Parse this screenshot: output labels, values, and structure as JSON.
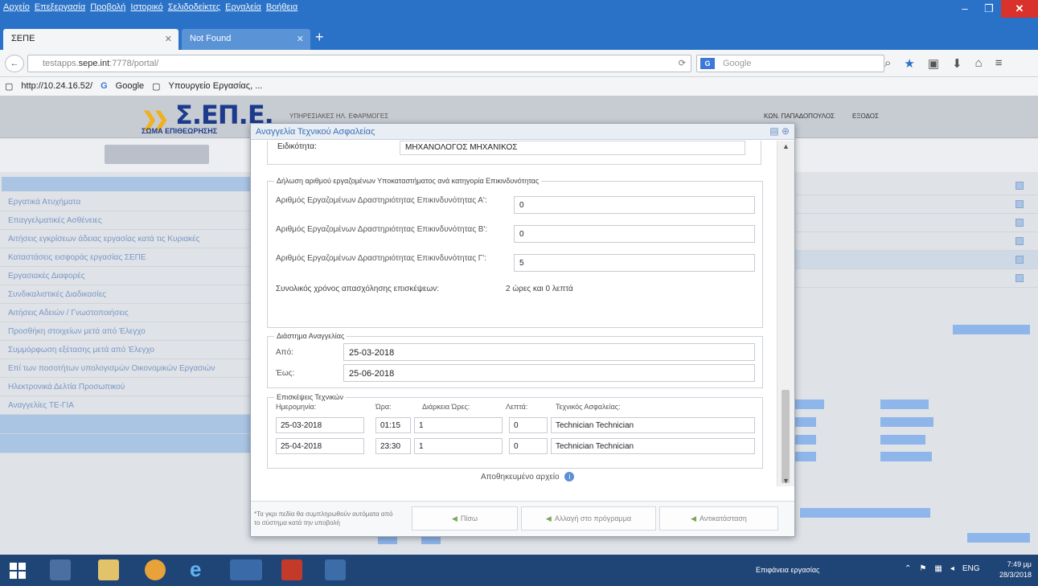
{
  "browser": {
    "menu": [
      "Αρχείο",
      "Επεξεργασία",
      "Προβολή",
      "Ιστορικό",
      "Σελιδοδείκτες",
      "Εργαλεία",
      "Βοήθεια"
    ],
    "tabs": [
      {
        "label": "ΣΕΠΕ"
      },
      {
        "label": "Not Found"
      }
    ],
    "url_prefix": "testapps.",
    "url_host": "sepe.int",
    "url_suffix": ":7778/portal/",
    "search_placeholder": "Google",
    "bookmarks": [
      "http://10.24.16.52/",
      "Google",
      "Υπουργείο Εργασίας, ..."
    ]
  },
  "header": {
    "logo_text": "Σ.ΕΠ.Ε.",
    "logo_subtitle": "ΣΩΜΑ ΕΠΙΘΕΩΡΗΣΗΣ",
    "subtitle": "ΥΠΗΡΕΣΙΑΚΕΣ ΗΛ. ΕΦΑΡΜΟΓΕΣ",
    "user": "ΚΩΝ. ΠΑΠΑΔΟΠΟΥΛΟΣ",
    "logout": "ΕΞΟΔΟΣ"
  },
  "sidebar": {
    "items": [
      "Εργατικά Ατυχήματα",
      "Επαγγελματικές Ασθένειες",
      "Αιτήσεις εγκρίσεων άδειας εργασίας κατά τις Κυριακές",
      "Καταστάσεις εισφοράς εργασίας ΣΕΠΕ",
      "Εργασιακές Διαφορές",
      "Συνδικαλιστικές Διαδικασίες",
      "Αιτήσεις Αδειών / Γνωστοποιήσεις",
      "Προσθήκη στοιχείων μετά από Έλεγχο",
      "Συμμόρφωση εξέτασης μετά από Έλεγχο",
      "Επί των ποσοτήτων υπολογισμών Οικονομικών Εργασιών",
      "Ηλεκτρονικά Δελτία Προσωπικού",
      "Αναγγελίες ΤΕ-ΓΙΑ"
    ]
  },
  "modal": {
    "title": "Αναγγελία Τεχνικού Ασφαλείας",
    "specialty_label": "Ειδικότητα:",
    "specialty_value": "ΜΗΧΑΝΟΛΟΓΟΣ ΜΗΧΑΝΙΚΟΣ",
    "employees_legend": "Δήλωση αριθμού εργαζομένων Υποκαταστήματος ανά κατηγορία Επικινδυνότητας",
    "employees": [
      {
        "label": "Αριθμός Εργαζομένων Δραστηριότητας Επικινδυνότητας Α':",
        "value": "0"
      },
      {
        "label": "Αριθμός Εργαζομένων Δραστηριότητας Επικινδυνότητας Β':",
        "value": "0"
      },
      {
        "label": "Αριθμός Εργαζομένων Δραστηριότητας Επικινδυνότητας Γ':",
        "value": "5"
      }
    ],
    "total_label": "Συνολικός χρόνος απασχόλησης επισκέψεων:",
    "total_value": "2 ώρες και 0 λεπτά",
    "period_legend": "Διάστημα Αναγγελίας",
    "from_label": "Από:",
    "from_value": "25-03-2018",
    "to_label": "Έως:",
    "to_value": "25-06-2018",
    "visits_legend": "Επισκέψεις Τεχνικών",
    "visit_headers": [
      "Ημερομηνία:",
      "Ώρα:",
      "Διάρκεια Ώρες:",
      "Λεπτά:",
      "Τεχνικός Ασφαλείας:"
    ],
    "visits": [
      {
        "date": "25-03-2018",
        "time": "01:15",
        "hours": "1",
        "minutes": "0",
        "tech": "Technician Technician"
      },
      {
        "date": "25-04-2018",
        "time": "23:30",
        "hours": "1",
        "minutes": "0",
        "tech": "Technician Technician"
      }
    ],
    "attachment_label": "Αποθηκευμένο αρχείο",
    "footer_note": "*Τα γκρι πεδία θα συμπληρωθούν αυτόματα από το σύστημα κατά την υποβολή",
    "buttons": {
      "print": "Πίσω",
      "send": "Αλλαγή στο πρόγραμμα",
      "cancel": "Αντικατάσταση"
    }
  },
  "taskbar": {
    "tray_label": "Επιφάνεια εργασίας",
    "lang": "ENG",
    "time": "7:49 μμ",
    "date": "28/3/2018"
  }
}
